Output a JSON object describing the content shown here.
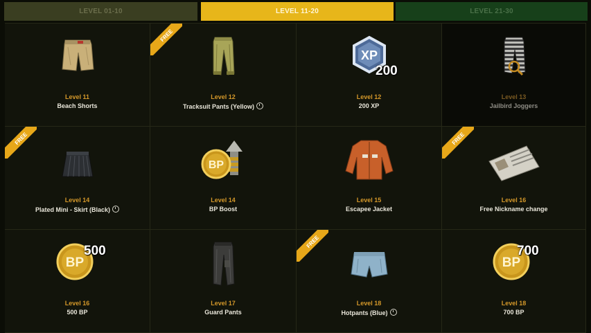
{
  "tabs": [
    {
      "label": "LEVEL 01-10",
      "state": "inactive"
    },
    {
      "label": "LEVEL 11-20",
      "state": "active"
    },
    {
      "label": "LEVEL 21-30",
      "state": "inactive"
    }
  ],
  "colors": {
    "accent": "#e7b61a",
    "level_text": "#d4982a",
    "free_ribbon": "#e7a719"
  },
  "rewards": [
    {
      "level": "Level 11",
      "name": "Beach Shorts",
      "icon": "beach-shorts-icon"
    },
    {
      "level": "Level 12",
      "name": "Tracksuit Pants (Yellow)",
      "icon": "tracksuit-pants-icon",
      "free": "FREE",
      "timed": true
    },
    {
      "level": "Level 12",
      "name": "200 XP",
      "icon": "xp-icon",
      "amount": "200",
      "badge": "XP"
    },
    {
      "level": "Level 13",
      "name": "Jailbird Joggers",
      "icon": "jailbird-joggers-icon",
      "dim": true
    },
    {
      "level": "Level 14",
      "name": "Plated Mini - Skirt (Black)",
      "icon": "mini-skirt-icon",
      "free": "FREE",
      "timed": true
    },
    {
      "level": "Level 14",
      "name": "BP Boost",
      "icon": "bp-boost-icon",
      "badge": "BP"
    },
    {
      "level": "Level 15",
      "name": "Escapee Jacket",
      "icon": "escapee-jacket-icon"
    },
    {
      "level": "Level 16",
      "name": "Free Nickname change",
      "icon": "nickname-card-icon",
      "free": "FREE"
    },
    {
      "level": "Level 16",
      "name": "500 BP",
      "icon": "bp-coin-icon",
      "amount": "500",
      "badge": "BP"
    },
    {
      "level": "Level 17",
      "name": "Guard Pants",
      "icon": "guard-pants-icon"
    },
    {
      "level": "Level 18",
      "name": "Hotpants (Blue)",
      "icon": "hotpants-icon",
      "free": "FREE",
      "timed": true
    },
    {
      "level": "Level 18",
      "name": "700 BP",
      "icon": "bp-coin-icon",
      "amount": "700",
      "badge": "BP"
    }
  ]
}
